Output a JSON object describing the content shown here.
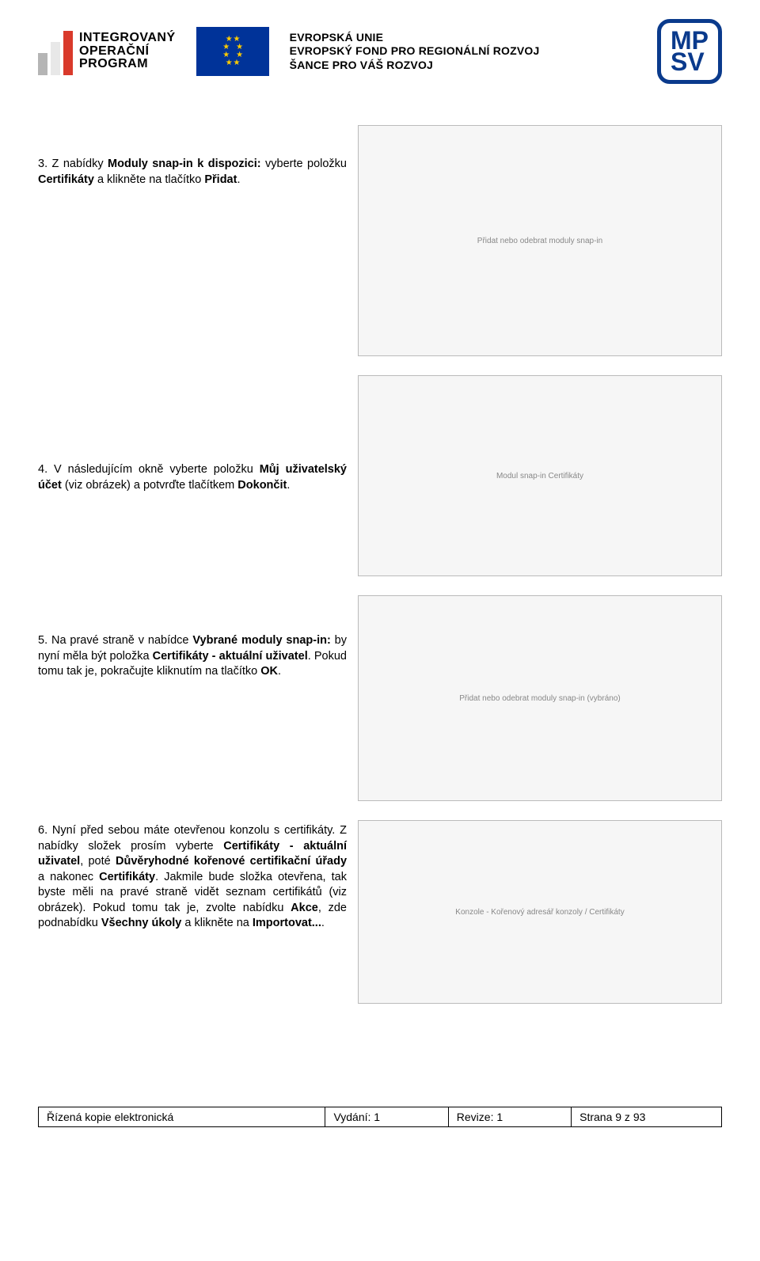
{
  "header": {
    "iop_line1": "INTEGROVANÝ",
    "iop_line2": "OPERAČNÍ",
    "iop_line3": "PROGRAM",
    "eu_line1": "EVROPSKÁ UNIE",
    "eu_line2": "EVROPSKÝ FOND PRO REGIONÁLNÍ ROZVOJ",
    "eu_line3": "ŠANCE PRO VÁŠ ROZVOJ",
    "mpsv": "MP\nSV"
  },
  "step3": {
    "prefix": "3. Z nabídky ",
    "b1": "Moduly snap-in k dispozici:",
    "mid1": " vyberte položku ",
    "b2": "Certifikáty",
    "mid2": " a klikněte na tlačítko ",
    "b3": "Přidat",
    "suffix": "."
  },
  "step4": {
    "prefix": "4. V následujícím okně vyberte položku ",
    "b1": "Můj uživatelský účet",
    "mid1": " (viz obrázek) a potvrďte tlačítkem ",
    "b2": "Dokončit",
    "suffix": "."
  },
  "step5": {
    "prefix": "5. Na pravé straně v nabídce ",
    "b1": "Vybrané moduly snap-in:",
    "mid1": " by nyní měla být položka ",
    "b2": "Certifikáty - aktuální uživatel",
    "mid2": ". Pokud tomu tak je, pokračujte kliknutím na tlačítko ",
    "b3": "OK",
    "suffix": "."
  },
  "step6": {
    "prefix": "6. Nyní před sebou máte otevřenou konzolu s certifikáty. Z nabídky složek prosím vyberte ",
    "b1": "Certifikáty - aktuální uživatel",
    "mid1": ", poté ",
    "b2": "Důvěryhodné kořenové certifikační úřady",
    "mid2": " a nakonec ",
    "b3": "Certifikáty",
    "mid3": ". Jakmile bude složka otevřena, tak byste měli na pravé straně vidět seznam certifikátů (viz obrázek). Pokud tomu tak je, zvolte nabídku ",
    "b4": "Akce",
    "mid4": ", zde podnabídku ",
    "b5": "Všechny úkoly",
    "mid5": " a klikněte na ",
    "b6": "Importovat...",
    "suffix": "."
  },
  "images": {
    "img1_alt": "Přidat nebo odebrat moduly snap-in",
    "img2_alt": "Modul snap-in Certifikáty",
    "img3_alt": "Přidat nebo odebrat moduly snap-in (vybráno)",
    "img4_alt": "Konzole - Kořenový adresář konzoly / Certifikáty"
  },
  "footer": {
    "c1": "Řízená kopie elektronická",
    "c2": "Vydání: 1",
    "c3": "Revize: 1",
    "c4": "Strana 9 z 93"
  }
}
